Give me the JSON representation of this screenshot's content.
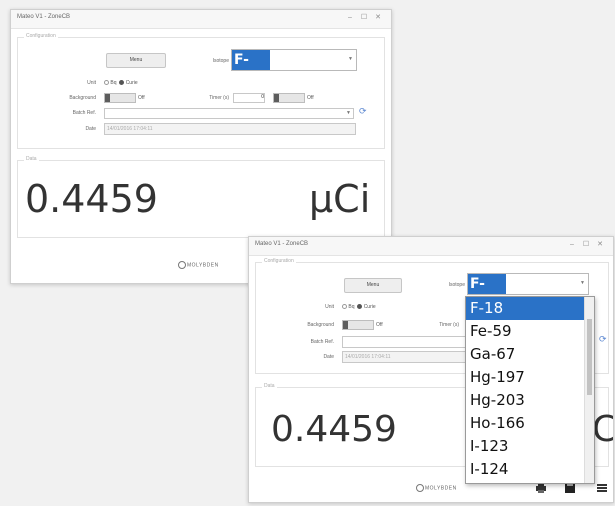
{
  "window": {
    "title": "Mateo V1 - ZoneCB",
    "controls": [
      "–",
      "☐",
      "✕"
    ],
    "panel_label": "Configuration",
    "display_label": "Data"
  },
  "form": {
    "menu_button": "Menu",
    "isotope_label": "Isotope",
    "isotope_value": "F-18",
    "unit_label": "Unit",
    "unit_bq": "Bq",
    "unit_curie": "Curie",
    "background_label": "Background",
    "background_state": "Off",
    "timer_label": "Timer (s)",
    "timer_value": "0",
    "timer_state": "Off",
    "batch_label": "Batch Ref.",
    "batch_value": "",
    "date_label": "Date",
    "date_value": "14/01/2016 17:04:11"
  },
  "reading": {
    "value": "0.4459",
    "unit": "μCi"
  },
  "logo_text": "MOLYBDEN",
  "dropdown": {
    "items": [
      "F-18",
      "Fe-59",
      "Ga-67",
      "Hg-197",
      "Hg-203",
      "Ho-166",
      "I-123",
      "I-124"
    ],
    "selected_index": 0
  },
  "toolbar_icons": [
    "print-icon",
    "save-icon",
    "settings-icon"
  ]
}
